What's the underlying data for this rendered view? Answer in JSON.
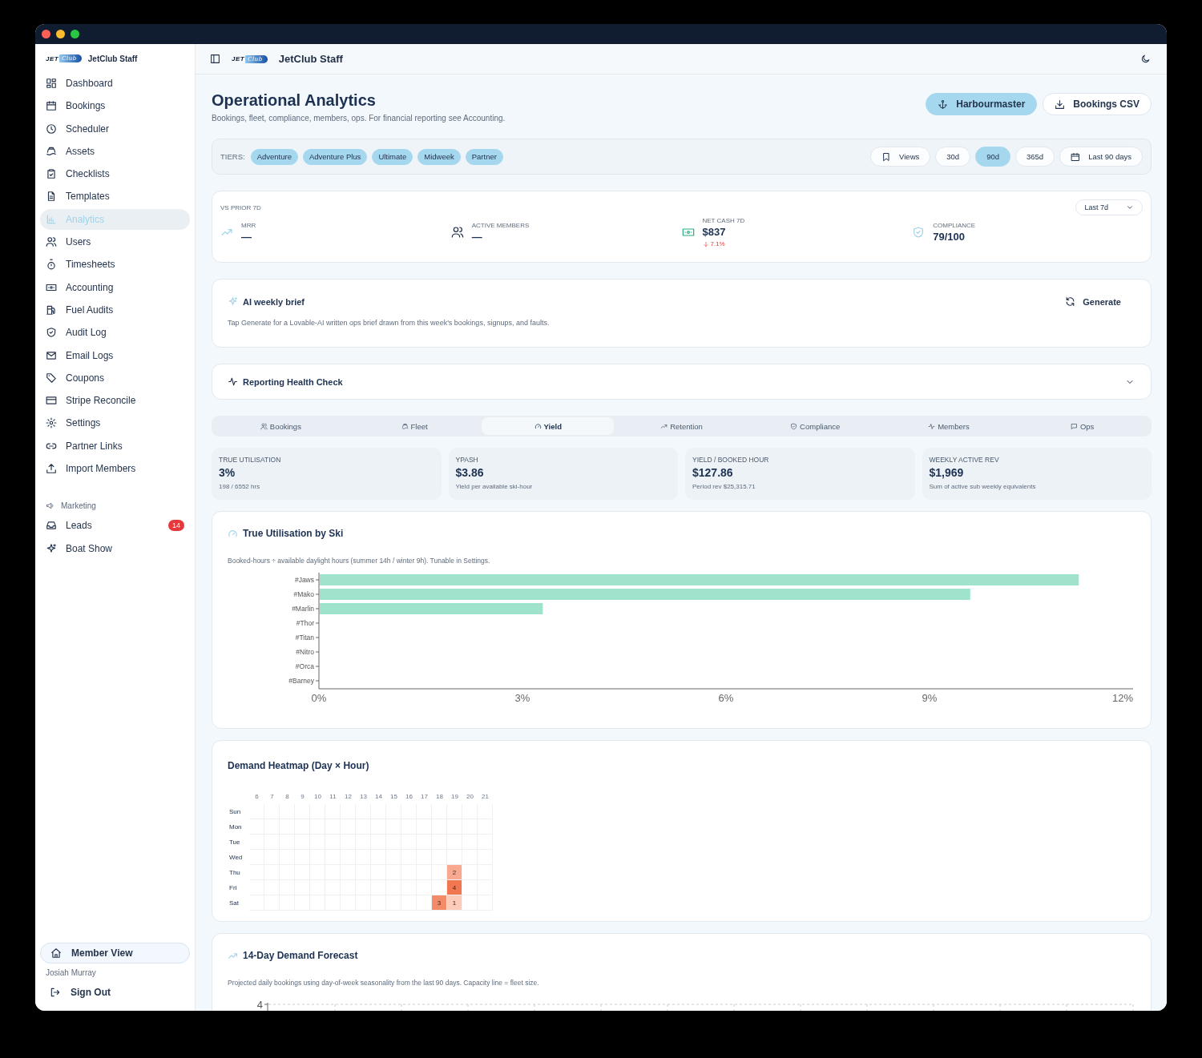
{
  "sidebar": {
    "logo": {
      "word": "JET",
      "script": "Club"
    },
    "brand": "JetClub Staff",
    "items": [
      {
        "label": "Dashboard",
        "selected": false
      },
      {
        "label": "Bookings",
        "selected": false
      },
      {
        "label": "Scheduler",
        "selected": false
      },
      {
        "label": "Assets",
        "selected": false
      },
      {
        "label": "Checklists",
        "selected": false
      },
      {
        "label": "Templates",
        "selected": false
      },
      {
        "label": "Analytics",
        "selected": true
      },
      {
        "label": "Users",
        "selected": false
      },
      {
        "label": "Timesheets",
        "selected": false
      },
      {
        "label": "Accounting",
        "selected": false
      },
      {
        "label": "Fuel Audits",
        "selected": false
      },
      {
        "label": "Audit Log",
        "selected": false
      },
      {
        "label": "Email Logs",
        "selected": false
      },
      {
        "label": "Coupons",
        "selected": false
      },
      {
        "label": "Stripe Reconcile",
        "selected": false
      },
      {
        "label": "Settings",
        "selected": false
      },
      {
        "label": "Partner Links",
        "selected": false
      },
      {
        "label": "Import Members",
        "selected": false
      }
    ],
    "section": "Marketing",
    "section_items": [
      {
        "label": "Leads",
        "badge": "14",
        "selected": false
      },
      {
        "label": "Boat Show",
        "selected": false
      }
    ],
    "member_view": "Member View",
    "user_name": "Josiah Murray",
    "sign_out": "Sign Out"
  },
  "header": {
    "logo": {
      "word": "JET",
      "script": "Club"
    },
    "title": "JetClub Staff"
  },
  "page": {
    "title": "Operational Analytics",
    "subtitle": "Bookings, fleet, compliance, members, ops. For financial reporting see Accounting.",
    "actions": [
      {
        "label": "Harbourmaster",
        "primary": true
      },
      {
        "label": "Bookings CSV",
        "primary": false
      }
    ]
  },
  "filters": {
    "tiers_label": "TIERS:",
    "tiers": [
      {
        "label": "Adventure",
        "selected": true
      },
      {
        "label": "Adventure Plus",
        "selected": true
      },
      {
        "label": "Ultimate",
        "selected": true
      },
      {
        "label": "Midweek",
        "selected": true
      },
      {
        "label": "Partner",
        "selected": true
      }
    ],
    "views": "Views",
    "ranges": [
      {
        "label": "30d",
        "selected": false
      },
      {
        "label": "90d",
        "selected": true
      },
      {
        "label": "365d",
        "selected": false
      }
    ],
    "date_range": "Last 90 days"
  },
  "kpis": {
    "caption": "VS PRIOR 7D",
    "period": "Last 7d",
    "items": [
      {
        "label": "MRR",
        "value": "—"
      },
      {
        "label": "ACTIVE MEMBERS",
        "value": "—"
      },
      {
        "label": "NET CASH 7D",
        "value": "$837",
        "delta": "7.1%",
        "negative": true
      },
      {
        "label": "COMPLIANCE",
        "value": "79/100"
      }
    ]
  },
  "ai_brief": {
    "title": "AI weekly brief",
    "action": "Generate",
    "text": "Tap Generate for a Lovable-AI written ops brief drawn from this week's bookings, signups, and faults."
  },
  "health_check": {
    "title": "Reporting Health Check",
    "expanded": false
  },
  "tabs": [
    {
      "label": "Bookings",
      "selected": false
    },
    {
      "label": "Fleet",
      "selected": false
    },
    {
      "label": "Yield",
      "selected": true
    },
    {
      "label": "Retention",
      "selected": false
    },
    {
      "label": "Compliance",
      "selected": false
    },
    {
      "label": "Members",
      "selected": false
    },
    {
      "label": "Ops",
      "selected": false
    }
  ],
  "stats": [
    {
      "label": "TRUE UTILISATION",
      "value": "3%",
      "note": "198 / 6552 hrs"
    },
    {
      "label": "YPASH",
      "value": "$3.86",
      "note": "Yield per available ski-hour"
    },
    {
      "label": "YIELD / BOOKED HOUR",
      "value": "$127.86",
      "note": "Period rev $25,315.71"
    },
    {
      "label": "WEEKLY ACTIVE REV",
      "value": "$1,969",
      "note": "Sum of active sub weekly equivalents"
    }
  ],
  "utilisation": {
    "title": "True Utilisation by Ski",
    "subtitle": "Booked-hours ÷ available daylight hours (summer 14h / winter 9h). Tunable in Settings.",
    "chart_data": {
      "type": "bar",
      "orientation": "horizontal",
      "categories": [
        "#Jaws",
        "#Mako",
        "#Marlin",
        "#Thor",
        "#Titan",
        "#Nitro",
        "#Orca",
        "#Barney"
      ],
      "values": [
        11.2,
        9.6,
        3.3,
        0,
        0,
        0,
        0,
        0
      ],
      "xlim": [
        0,
        12
      ],
      "xticks": [
        {
          "value": 0,
          "label": "0%"
        },
        {
          "value": 3,
          "label": "3%"
        },
        {
          "value": 6,
          "label": "6%"
        },
        {
          "value": 9,
          "label": "9%"
        },
        {
          "value": 12,
          "label": "12%"
        }
      ]
    }
  },
  "heatmap": {
    "title": "Demand Heatmap (Day × Hour)",
    "hours": [
      "6",
      "7",
      "8",
      "9",
      "10",
      "11",
      "12",
      "13",
      "14",
      "15",
      "16",
      "17",
      "18",
      "19",
      "20",
      "21"
    ],
    "rows": [
      {
        "day": "Sun",
        "cells": [
          {
            "filled": false
          },
          {
            "filled": false
          },
          {
            "filled": false
          },
          {
            "filled": false
          },
          {
            "filled": false
          },
          {
            "filled": false
          },
          {
            "filled": false
          },
          {
            "filled": false
          },
          {
            "filled": false
          },
          {
            "filled": false
          },
          {
            "filled": false
          },
          {
            "filled": false
          },
          {
            "filled": false
          },
          {
            "filled": false
          },
          {
            "filled": false
          },
          {
            "filled": false
          }
        ]
      },
      {
        "day": "Mon",
        "cells": [
          {
            "filled": false
          },
          {
            "filled": false
          },
          {
            "filled": false
          },
          {
            "filled": false
          },
          {
            "filled": false
          },
          {
            "filled": false
          },
          {
            "filled": false
          },
          {
            "filled": false
          },
          {
            "filled": false
          },
          {
            "filled": false
          },
          {
            "filled": false
          },
          {
            "filled": false
          },
          {
            "filled": false
          },
          {
            "filled": false
          },
          {
            "filled": false
          },
          {
            "filled": false
          }
        ]
      },
      {
        "day": "Tue",
        "cells": [
          {
            "filled": false
          },
          {
            "filled": false
          },
          {
            "filled": false
          },
          {
            "filled": false
          },
          {
            "filled": false
          },
          {
            "filled": false
          },
          {
            "filled": false
          },
          {
            "filled": false
          },
          {
            "filled": false
          },
          {
            "filled": false
          },
          {
            "filled": false
          },
          {
            "filled": false
          },
          {
            "filled": false
          },
          {
            "filled": false
          },
          {
            "filled": false
          },
          {
            "filled": false
          }
        ]
      },
      {
        "day": "Wed",
        "cells": [
          {
            "filled": false
          },
          {
            "filled": false
          },
          {
            "filled": false
          },
          {
            "filled": false
          },
          {
            "filled": false
          },
          {
            "filled": false
          },
          {
            "filled": false
          },
          {
            "filled": false
          },
          {
            "filled": false
          },
          {
            "filled": false
          },
          {
            "filled": false
          },
          {
            "filled": false
          },
          {
            "filled": false
          },
          {
            "filled": false
          },
          {
            "filled": false
          },
          {
            "filled": false
          }
        ]
      },
      {
        "day": "Thu",
        "cells": [
          {
            "filled": false
          },
          {
            "filled": false
          },
          {
            "filled": false
          },
          {
            "filled": false
          },
          {
            "filled": false
          },
          {
            "filled": false
          },
          {
            "filled": false
          },
          {
            "filled": false
          },
          {
            "filled": false
          },
          {
            "filled": false
          },
          {
            "filled": false
          },
          {
            "filled": false
          },
          {
            "filled": false
          },
          {
            "filled": true,
            "count": "2",
            "color": "#f9a98f"
          },
          {
            "filled": false
          },
          {
            "filled": false
          }
        ]
      },
      {
        "day": "Fri",
        "cells": [
          {
            "filled": false
          },
          {
            "filled": false
          },
          {
            "filled": false
          },
          {
            "filled": false
          },
          {
            "filled": false
          },
          {
            "filled": false
          },
          {
            "filled": false
          },
          {
            "filled": false
          },
          {
            "filled": false
          },
          {
            "filled": false
          },
          {
            "filled": false
          },
          {
            "filled": false
          },
          {
            "filled": false
          },
          {
            "filled": true,
            "count": "4",
            "color": "#f0774f"
          },
          {
            "filled": false
          },
          {
            "filled": false
          }
        ]
      },
      {
        "day": "Sat",
        "cells": [
          {
            "filled": false
          },
          {
            "filled": false
          },
          {
            "filled": false
          },
          {
            "filled": false
          },
          {
            "filled": false
          },
          {
            "filled": false
          },
          {
            "filled": false
          },
          {
            "filled": false
          },
          {
            "filled": false
          },
          {
            "filled": false
          },
          {
            "filled": false
          },
          {
            "filled": false
          },
          {
            "filled": true,
            "count": "3",
            "color": "#f38a68"
          },
          {
            "filled": true,
            "count": "1",
            "color": "#fccbb9"
          },
          {
            "filled": false
          },
          {
            "filled": false
          }
        ]
      }
    ]
  },
  "forecast": {
    "title": "14-Day Demand Forecast",
    "subtitle": "Projected daily bookings using day-of-week seasonality from the last 90 days. Capacity line = fleet size.",
    "y_tick": "4"
  }
}
